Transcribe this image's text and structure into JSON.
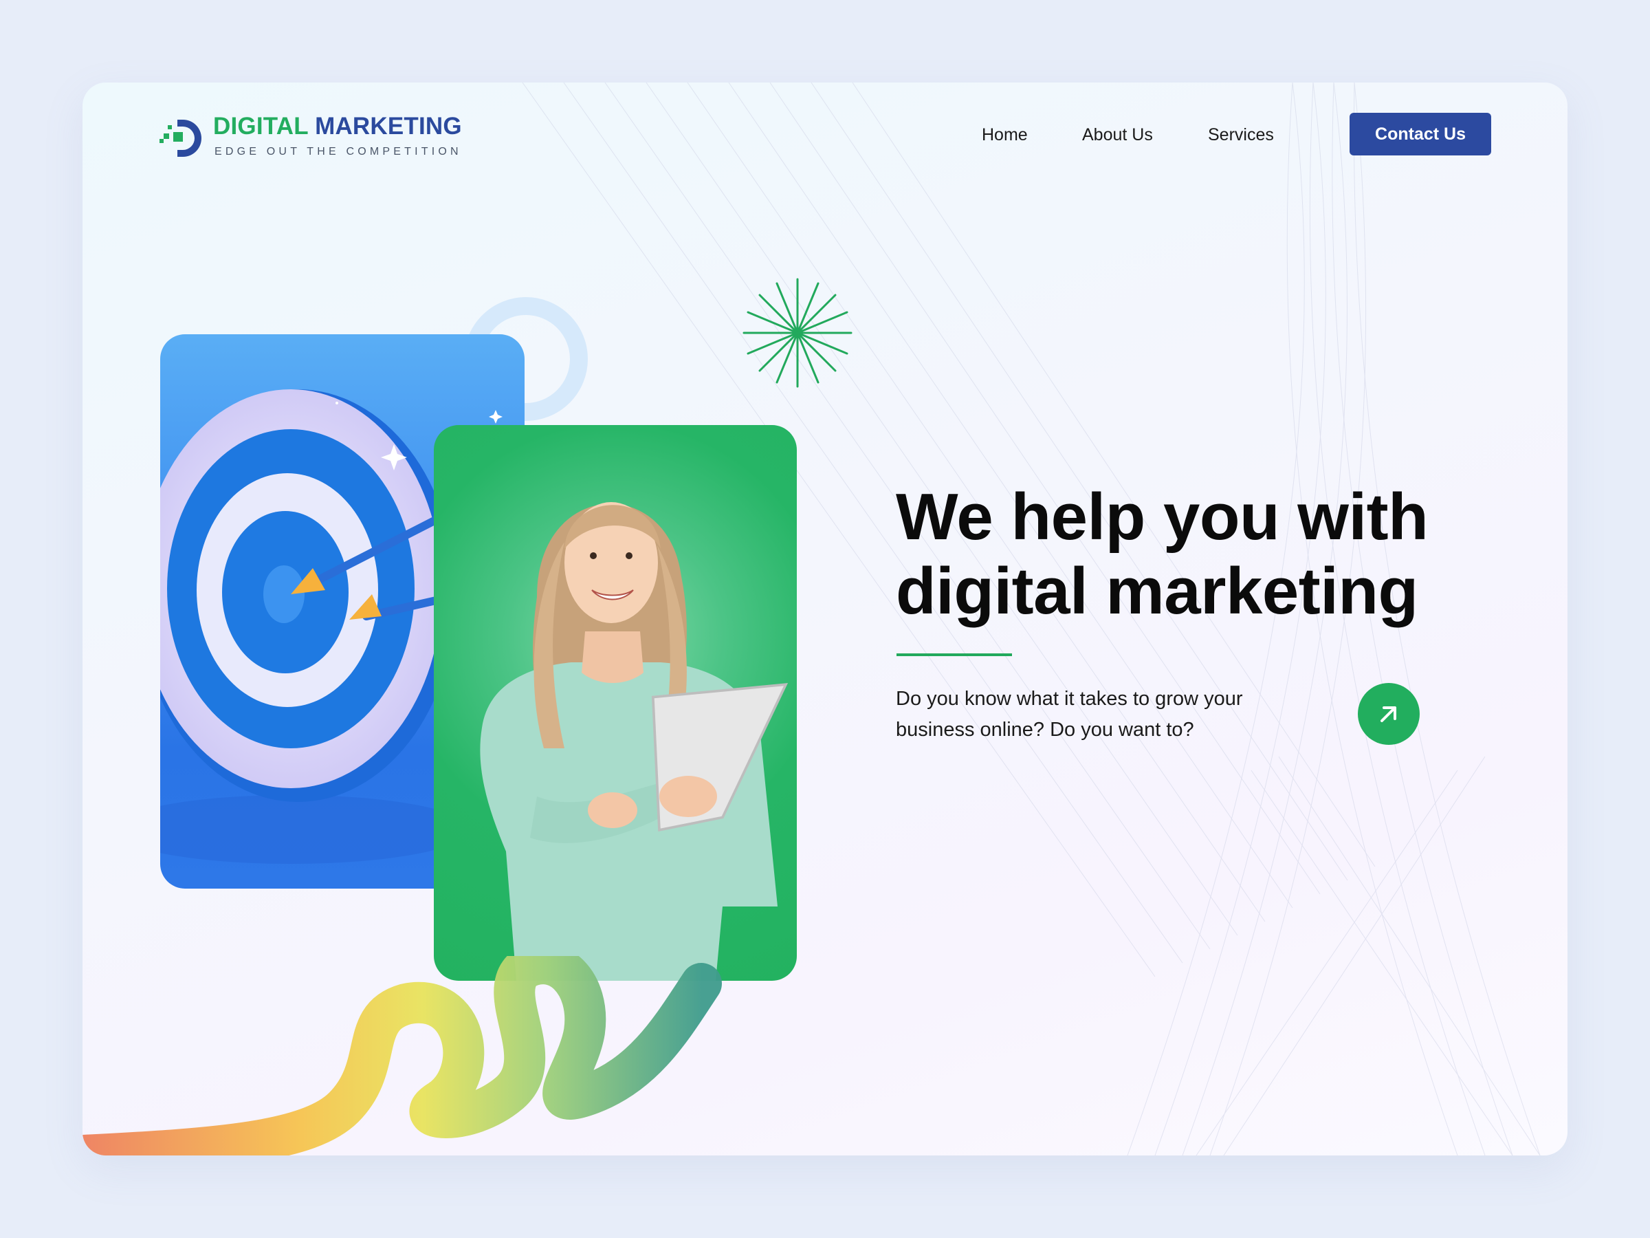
{
  "brand": {
    "title_part1": "DIGITAL",
    "title_part2": "MARKETING",
    "tagline": "EDGE OUT THE COMPETITION",
    "accent_green": "#23ad5f",
    "accent_blue": "#2b4a9e"
  },
  "nav": {
    "items": [
      {
        "label": "Home"
      },
      {
        "label": "About Us"
      },
      {
        "label": "Services"
      }
    ],
    "cta_label": "Contact Us",
    "cta_color": "#2c4aa0"
  },
  "hero": {
    "title_line1": "We help you with",
    "title_line2": "digital marketing",
    "description": "Do you know what it takes to grow your business online? Do you want to?",
    "arrow_icon": "arrow-up-right-icon",
    "arrow_color": "#22ae5e"
  },
  "illustrations": {
    "target_card_icon": "archery-target-icon",
    "person_card_icon": "woman-with-tablet-photo",
    "burst_icon": "sparkle-burst-icon",
    "swirl_icon": "gradient-ribbon-swirl"
  }
}
